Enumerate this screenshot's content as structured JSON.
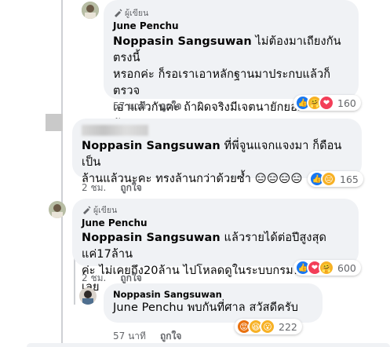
{
  "comments": [
    {
      "author_badge": "ผู้เขียน",
      "author": "June Penchu",
      "tag": "Noppasin Sangsuwan",
      "text": " ไม่ต้องมาเถียงกันตรงนี้\nหรอกค่ะ ก็รอเราเอาหลักฐานมาประกบแล้วก็ตรวจ\nเอาแล้วกันค่ะ ถ้าผิดจริงมีเจตนายักยอกจริงก็ว่ากัน\nไปตามนั้นเลย เราก็ต้องยอมรับ",
      "time": "57 นาที",
      "like": "ถูกใจ",
      "reaction_count": "160"
    },
    {
      "tag": "Noppasin Sangsuwan",
      "text": " ที่พี่จูนแจกแจงมา ก็ดือนเป็น\nล้านแล้วนะคะ ทรงล้านกว่าด้วยซ้ำ 😑😑😑😑",
      "time": "2 ชม.",
      "like": "ถูกใจ",
      "reaction_count": "165"
    },
    {
      "author_badge": "ผู้เขียน",
      "author": "June Penchu",
      "tag": "Noppasin Sangsuwan",
      "text": " แล้วรายได้ต่อปีสูงสุดแค่17ล้าน\nค่ะ ไม่เคยถึง20ล้าน ไปโหลดดูในระบบกรมพัฒน์ได้เลย",
      "time": "2 ชม.",
      "like": "ถูกใจ",
      "reaction_count": "600"
    },
    {
      "author": "Noppasin Sangsuwan",
      "tag": "June Penchu",
      "text": " พบกันที่ศาล สวัสดีครับ",
      "time": "57 นาที",
      "like": "ถูกใจ",
      "reaction_count": "222"
    }
  ],
  "colors": {
    "bubble": "#f0f2f5",
    "meta_text": "#65676b",
    "like_blue": "#1877f2",
    "love_red": "#f33e58",
    "haha_yellow": "#f7b125",
    "thread_line": "#ced0d4"
  }
}
